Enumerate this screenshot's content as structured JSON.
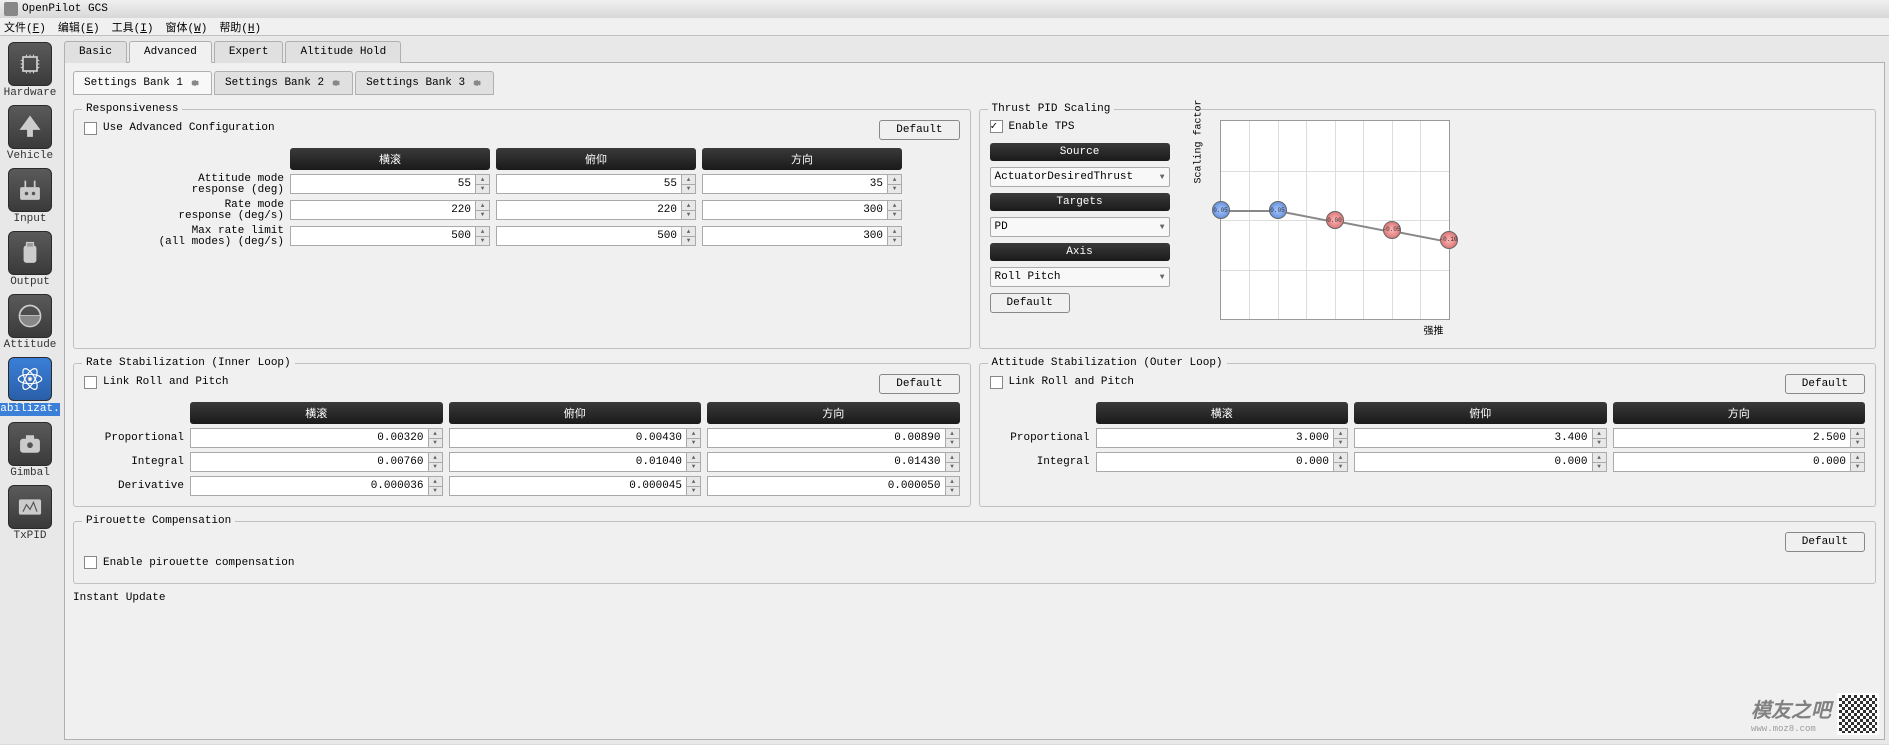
{
  "app": {
    "title": "OpenPilot GCS"
  },
  "menubar": {
    "file": "文件(F)",
    "edit": "编辑(E)",
    "tools": "工具(I)",
    "window": "窗体(W)",
    "help": "帮助(H)"
  },
  "sidebar": {
    "items": [
      {
        "label": "Hardware"
      },
      {
        "label": "Vehicle"
      },
      {
        "label": "Input"
      },
      {
        "label": "Output"
      },
      {
        "label": "Attitude"
      },
      {
        "label": "Stabilizat..."
      },
      {
        "label": "Gimbal"
      },
      {
        "label": "TxPID"
      }
    ]
  },
  "tabs": {
    "items": [
      "Basic",
      "Advanced",
      "Expert",
      "Altitude Hold"
    ],
    "active": 1
  },
  "subtabs": {
    "items": [
      "Settings Bank 1",
      "Settings Bank 2",
      "Settings Bank 3"
    ],
    "active": 0
  },
  "responsiveness": {
    "title": "Responsiveness",
    "use_advanced": "Use Advanced Configuration",
    "default_btn": "Default",
    "cols": [
      "横滚",
      "俯仰",
      "方向"
    ],
    "rows": [
      {
        "label": "Attitude mode\nresponse (deg)",
        "vals": [
          "55",
          "55",
          "35"
        ]
      },
      {
        "label": "Rate mode\nresponse (deg/s)",
        "vals": [
          "220",
          "220",
          "300"
        ]
      },
      {
        "label": "Max rate limit\n(all modes) (deg/s)",
        "vals": [
          "500",
          "500",
          "300"
        ]
      }
    ]
  },
  "thrust": {
    "title": "Thrust PID Scaling",
    "enable": "Enable TPS",
    "source_hdr": "Source",
    "source_val": "ActuatorDesiredThrust",
    "targets_hdr": "Targets",
    "targets_val": "PD",
    "axis_hdr": "Axis",
    "axis_val": "Roll Pitch",
    "default_btn": "Default",
    "ylabel": "Scaling factor",
    "xlabel": "强推"
  },
  "rate_stab": {
    "title": "Rate Stabilization (Inner Loop)",
    "link": "Link Roll and Pitch",
    "default_btn": "Default",
    "cols": [
      "横滚",
      "俯仰",
      "方向"
    ],
    "rows": [
      {
        "label": "Proportional",
        "vals": [
          "0.00320",
          "0.00430",
          "0.00890"
        ]
      },
      {
        "label": "Integral",
        "vals": [
          "0.00760",
          "0.01040",
          "0.01430"
        ]
      },
      {
        "label": "Derivative",
        "vals": [
          "0.000036",
          "0.000045",
          "0.000050"
        ]
      }
    ]
  },
  "att_stab": {
    "title": "Attitude Stabilization (Outer Loop)",
    "link": "Link Roll and Pitch",
    "default_btn": "Default",
    "cols": [
      "横滚",
      "俯仰",
      "方向"
    ],
    "rows": [
      {
        "label": "Proportional",
        "vals": [
          "3.000",
          "3.400",
          "2.500"
        ]
      },
      {
        "label": "Integral",
        "vals": [
          "0.000",
          "0.000",
          "0.000"
        ]
      }
    ]
  },
  "pirouette": {
    "title": "Pirouette Compensation",
    "enable": "Enable pirouette compensation",
    "default_btn": "Default"
  },
  "instant": {
    "title": "Instant Update"
  },
  "watermark": {
    "logo": "模友之吧",
    "url": "www.moz8.com"
  },
  "chart_data": {
    "type": "line",
    "title": "",
    "xlabel": "强推",
    "ylabel": "Scaling factor",
    "x": [
      0.0,
      0.25,
      0.5,
      0.75,
      1.0
    ],
    "values": [
      0.05,
      0.05,
      0.0,
      -0.05,
      -0.1
    ],
    "ylim": [
      -0.5,
      0.5
    ],
    "xlim": [
      0,
      1
    ]
  }
}
